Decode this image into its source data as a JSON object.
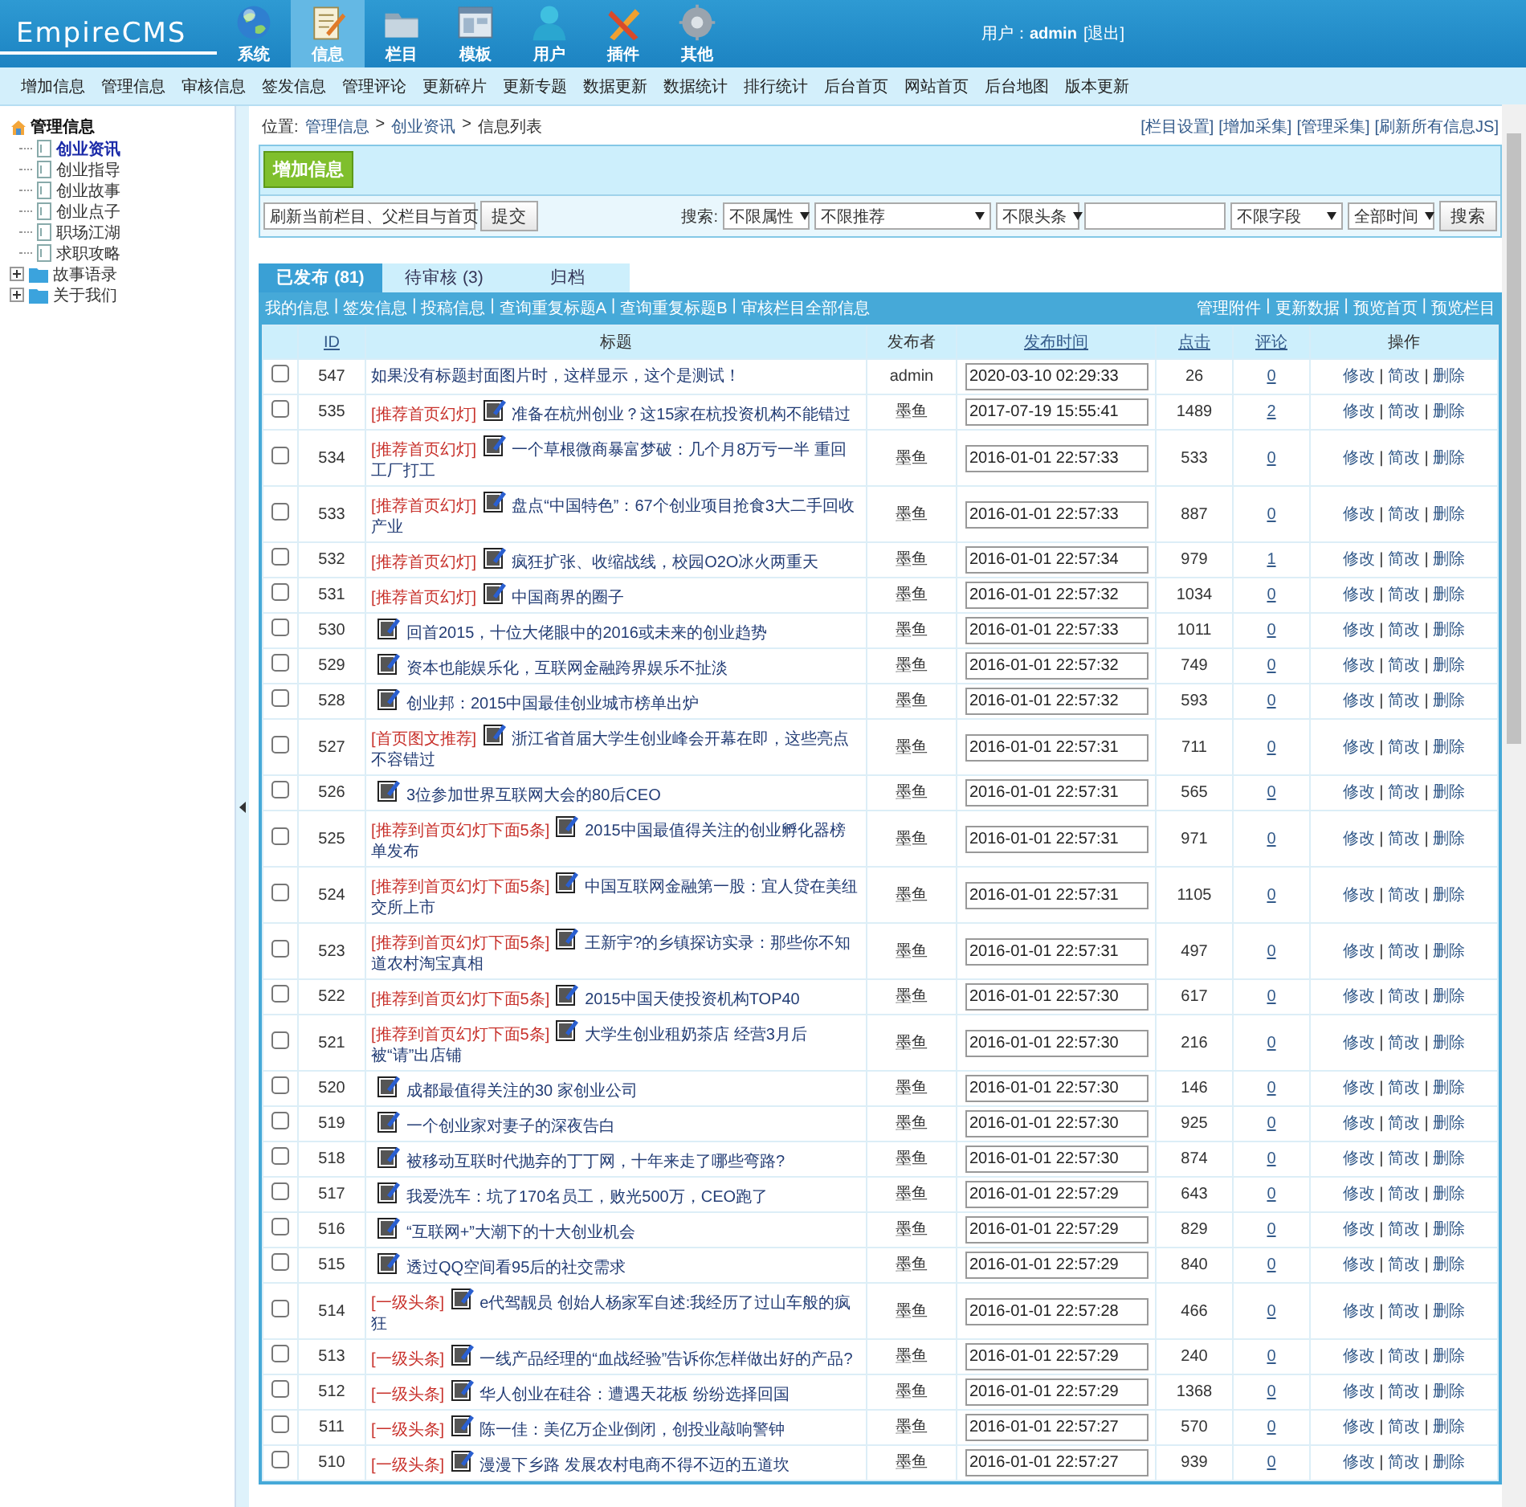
{
  "header": {
    "logo": "EmpireCMS",
    "nav": [
      {
        "label": "系统",
        "selected": false
      },
      {
        "label": "信息",
        "selected": true
      },
      {
        "label": "栏目",
        "selected": false
      },
      {
        "label": "模板",
        "selected": false
      },
      {
        "label": "用户",
        "selected": false
      },
      {
        "label": "插件",
        "selected": false
      },
      {
        "label": "其他",
        "selected": false
      }
    ],
    "user_label": "用户：",
    "user": "admin",
    "logout": "[退出]"
  },
  "menu": [
    "增加信息",
    "管理信息",
    "审核信息",
    "签发信息",
    "管理评论",
    "更新碎片",
    "更新专题",
    "数据更新",
    "数据统计",
    "排行统计",
    "后台首页",
    "网站首页",
    "后台地图",
    "版本更新"
  ],
  "sidebar": {
    "root": "管理信息",
    "items": [
      {
        "label": "创业资讯",
        "kind": "page",
        "selected": true
      },
      {
        "label": "创业指导",
        "kind": "page",
        "selected": false
      },
      {
        "label": "创业故事",
        "kind": "page",
        "selected": false
      },
      {
        "label": "创业点子",
        "kind": "page",
        "selected": false
      },
      {
        "label": "职场江湖",
        "kind": "page",
        "selected": false
      },
      {
        "label": "求职攻略",
        "kind": "page",
        "selected": false
      },
      {
        "label": "故事语录",
        "kind": "folder",
        "selected": false
      },
      {
        "label": "关于我们",
        "kind": "folder",
        "selected": false
      }
    ]
  },
  "breadcrumb": {
    "label": "位置:",
    "separator": ">",
    "path": [
      "管理信息",
      "创业资讯",
      "信息列表"
    ]
  },
  "top_links": [
    "[栏目设置]",
    "[增加采集]",
    "[管理采集]",
    "[刷新所有信息JS]"
  ],
  "add_button": "增加信息",
  "refresh_select": "刷新当前栏目、父栏目与首页",
  "submit": "提交",
  "search": {
    "label": "搜索:",
    "filters": [
      "不限属性",
      "不限推荐",
      "不限头条"
    ],
    "field_select": "不限字段",
    "time_select": "全部时间",
    "button": "搜索"
  },
  "tabs": [
    {
      "label": "已发布 (81)",
      "selected": true
    },
    {
      "label": "待审核 (3)",
      "selected": false
    },
    {
      "label": "归档",
      "selected": false
    }
  ],
  "sub_links": {
    "separator": "|",
    "left": [
      "我的信息",
      "签发信息",
      "投稿信息",
      "查询重复标题A",
      "查询重复标题B",
      "审核栏目全部信息"
    ],
    "right": [
      "管理附件",
      "更新数据",
      "预览首页",
      "预览栏目"
    ]
  },
  "table": {
    "columns": [
      {
        "label": "ID",
        "sortable": true
      },
      {
        "label": "标题",
        "sortable": false
      },
      {
        "label": "发布者",
        "sortable": false
      },
      {
        "label": "发布时间",
        "sortable": true
      },
      {
        "label": "点击",
        "sortable": true
      },
      {
        "label": "评论",
        "sortable": true
      },
      {
        "label": "操作",
        "sortable": false
      }
    ],
    "rows": [
      {
        "checked": false,
        "id": "547",
        "title": "如果没有标题封面图片时，这样显示，这个是测试！",
        "has_image": false,
        "publisher": "admin",
        "time": "2020-03-10 02:29:33",
        "clicks": "26",
        "comments": "0",
        "actions": [
          "修改",
          "简改",
          "删除"
        ]
      },
      {
        "checked": false,
        "id": "535",
        "flag": "[推荐首页幻灯]",
        "title": "准备在杭州创业？这15家在杭投资机构不能错过",
        "has_image": true,
        "publisher": "墨鱼",
        "time": "2017-07-19 15:55:41",
        "clicks": "1489",
        "comments": "2",
        "actions": [
          "修改",
          "简改",
          "删除"
        ]
      },
      {
        "checked": false,
        "id": "534",
        "flag": "[推荐首页幻灯]",
        "title": "一个草根微商暴富梦破：几个月8万亏一半 重回工厂打工",
        "has_image": true,
        "publisher": "墨鱼",
        "time": "2016-01-01 22:57:33",
        "clicks": "533",
        "comments": "0",
        "actions": [
          "修改",
          "简改",
          "删除"
        ]
      },
      {
        "checked": false,
        "id": "533",
        "flag": "[推荐首页幻灯]",
        "title": "盘点“中国特色”：67个创业项目抢食3大二手回收产业",
        "has_image": true,
        "publisher": "墨鱼",
        "time": "2016-01-01 22:57:33",
        "clicks": "887",
        "comments": "0",
        "actions": [
          "修改",
          "简改",
          "删除"
        ]
      },
      {
        "checked": false,
        "id": "532",
        "flag": "[推荐首页幻灯]",
        "title": "疯狂扩张、收缩战线，校园O2O冰火两重天",
        "has_image": true,
        "publisher": "墨鱼",
        "time": "2016-01-01 22:57:34",
        "clicks": "979",
        "comments": "1",
        "actions": [
          "修改",
          "简改",
          "删除"
        ]
      },
      {
        "checked": false,
        "id": "531",
        "flag": "[推荐首页幻灯]",
        "title": "中国商界的圈子",
        "has_image": true,
        "publisher": "墨鱼",
        "time": "2016-01-01 22:57:32",
        "clicks": "1034",
        "comments": "0",
        "actions": [
          "修改",
          "简改",
          "删除"
        ]
      },
      {
        "checked": false,
        "id": "530",
        "title": "回首2015，十位大佬眼中的2016或未来的创业趋势",
        "has_image": true,
        "publisher": "墨鱼",
        "time": "2016-01-01 22:57:33",
        "clicks": "1011",
        "comments": "0",
        "actions": [
          "修改",
          "简改",
          "删除"
        ]
      },
      {
        "checked": false,
        "id": "529",
        "title": "资本也能娱乐化，互联网金融跨界娱乐不扯淡",
        "has_image": true,
        "publisher": "墨鱼",
        "time": "2016-01-01 22:57:32",
        "clicks": "749",
        "comments": "0",
        "actions": [
          "修改",
          "简改",
          "删除"
        ]
      },
      {
        "checked": false,
        "id": "528",
        "title": "创业邦：2015中国最佳创业城市榜单出炉",
        "has_image": true,
        "publisher": "墨鱼",
        "time": "2016-01-01 22:57:32",
        "clicks": "593",
        "comments": "0",
        "actions": [
          "修改",
          "简改",
          "删除"
        ]
      },
      {
        "checked": false,
        "id": "527",
        "flag": "[首页图文推荐]",
        "title": "浙江省首届大学生创业峰会开幕在即，这些亮点不容错过",
        "has_image": true,
        "publisher": "墨鱼",
        "time": "2016-01-01 22:57:31",
        "clicks": "711",
        "comments": "0",
        "actions": [
          "修改",
          "简改",
          "删除"
        ]
      },
      {
        "checked": false,
        "id": "526",
        "title": "3位参加世界互联网大会的80后CEO",
        "has_image": true,
        "publisher": "墨鱼",
        "time": "2016-01-01 22:57:31",
        "clicks": "565",
        "comments": "0",
        "actions": [
          "修改",
          "简改",
          "删除"
        ]
      },
      {
        "checked": false,
        "id": "525",
        "flag": "[推荐到首页幻灯下面5条]",
        "title": "2015中国最值得关注的创业孵化器榜单发布",
        "has_image": true,
        "publisher": "墨鱼",
        "time": "2016-01-01 22:57:31",
        "clicks": "971",
        "comments": "0",
        "actions": [
          "修改",
          "简改",
          "删除"
        ]
      },
      {
        "checked": false,
        "id": "524",
        "flag": "[推荐到首页幻灯下面5条]",
        "title": "中国互联网金融第一股：宜人贷在美纽交所上市",
        "has_image": true,
        "publisher": "墨鱼",
        "time": "2016-01-01 22:57:31",
        "clicks": "1105",
        "comments": "0",
        "actions": [
          "修改",
          "简改",
          "删除"
        ]
      },
      {
        "checked": false,
        "id": "523",
        "flag": "[推荐到首页幻灯下面5条]",
        "title": "王新宇?的乡镇探访实录：那些你不知道农村淘宝真相",
        "has_image": true,
        "publisher": "墨鱼",
        "time": "2016-01-01 22:57:31",
        "clicks": "497",
        "comments": "0",
        "actions": [
          "修改",
          "简改",
          "删除"
        ]
      },
      {
        "checked": false,
        "id": "522",
        "flag": "[推荐到首页幻灯下面5条]",
        "title": "2015中国天使投资机构TOP40",
        "has_image": true,
        "publisher": "墨鱼",
        "time": "2016-01-01 22:57:30",
        "clicks": "617",
        "comments": "0",
        "actions": [
          "修改",
          "简改",
          "删除"
        ]
      },
      {
        "checked": false,
        "id": "521",
        "flag": "[推荐到首页幻灯下面5条]",
        "title": "大学生创业租奶茶店 经营3月后被“请”出店铺",
        "has_image": true,
        "publisher": "墨鱼",
        "time": "2016-01-01 22:57:30",
        "clicks": "216",
        "comments": "0",
        "actions": [
          "修改",
          "简改",
          "删除"
        ]
      },
      {
        "checked": false,
        "id": "520",
        "title": "成都最值得关注的30 家创业公司",
        "has_image": true,
        "publisher": "墨鱼",
        "time": "2016-01-01 22:57:30",
        "clicks": "146",
        "comments": "0",
        "actions": [
          "修改",
          "简改",
          "删除"
        ]
      },
      {
        "checked": false,
        "id": "519",
        "title": "一个创业家对妻子的深夜告白",
        "has_image": true,
        "publisher": "墨鱼",
        "time": "2016-01-01 22:57:30",
        "clicks": "925",
        "comments": "0",
        "actions": [
          "修改",
          "简改",
          "删除"
        ]
      },
      {
        "checked": false,
        "id": "518",
        "title": "被移动互联时代抛弃的丁丁网，十年来走了哪些弯路?",
        "has_image": true,
        "publisher": "墨鱼",
        "time": "2016-01-01 22:57:30",
        "clicks": "874",
        "comments": "0",
        "actions": [
          "修改",
          "简改",
          "删除"
        ]
      },
      {
        "checked": false,
        "id": "517",
        "title": "我爱洗车：坑了170名员工，败光500万，CEO跑了",
        "has_image": true,
        "publisher": "墨鱼",
        "time": "2016-01-01 22:57:29",
        "clicks": "643",
        "comments": "0",
        "actions": [
          "修改",
          "简改",
          "删除"
        ]
      },
      {
        "checked": false,
        "id": "516",
        "title": "“互联网+”大潮下的十大创业机会",
        "has_image": true,
        "publisher": "墨鱼",
        "time": "2016-01-01 22:57:29",
        "clicks": "829",
        "comments": "0",
        "actions": [
          "修改",
          "简改",
          "删除"
        ]
      },
      {
        "checked": false,
        "id": "515",
        "title": "透过QQ空间看95后的社交需求",
        "has_image": true,
        "publisher": "墨鱼",
        "time": "2016-01-01 22:57:29",
        "clicks": "840",
        "comments": "0",
        "actions": [
          "修改",
          "简改",
          "删除"
        ]
      },
      {
        "checked": false,
        "id": "514",
        "flag": "[一级头条]",
        "title": "e代驾靓员 创始人杨家军自述:我经历了过山车般的疯狂",
        "has_image": true,
        "publisher": "墨鱼",
        "time": "2016-01-01 22:57:28",
        "clicks": "466",
        "comments": "0",
        "actions": [
          "修改",
          "简改",
          "删除"
        ]
      },
      {
        "checked": false,
        "id": "513",
        "flag": "[一级头条]",
        "title": "一线产品经理的“血战经验”告诉你怎样做出好的产品?",
        "has_image": true,
        "publisher": "墨鱼",
        "time": "2016-01-01 22:57:29",
        "clicks": "240",
        "comments": "0",
        "actions": [
          "修改",
          "简改",
          "删除"
        ]
      },
      {
        "checked": false,
        "id": "512",
        "flag": "[一级头条]",
        "title": "华人创业在硅谷：遭遇天花板 纷纷选择回国",
        "has_image": true,
        "publisher": "墨鱼",
        "time": "2016-01-01 22:57:29",
        "clicks": "1368",
        "comments": "0",
        "actions": [
          "修改",
          "简改",
          "删除"
        ]
      },
      {
        "checked": false,
        "id": "511",
        "flag": "[一级头条]",
        "title": "陈一佳：美亿万企业倒闭，创投业敲响警钟",
        "has_image": true,
        "publisher": "墨鱼",
        "time": "2016-01-01 22:57:27",
        "clicks": "570",
        "comments": "0",
        "actions": [
          "修改",
          "简改",
          "删除"
        ]
      },
      {
        "checked": false,
        "id": "510",
        "flag": "[一级头条]",
        "title": "漫漫下乡路 发展农村电商不得不迈的五道坎",
        "has_image": true,
        "publisher": "墨鱼",
        "time": "2016-01-01 22:57:27",
        "clicks": "939",
        "comments": "0",
        "actions": [
          "修改",
          "简改",
          "删除"
        ]
      }
    ]
  }
}
